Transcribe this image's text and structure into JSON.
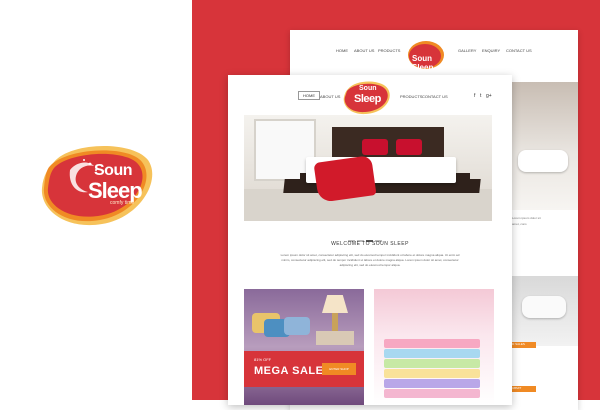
{
  "brand": {
    "name_line1": "Soun",
    "name_line2": "Sleep",
    "tagline": "comfy time",
    "color_primary": "#d7343a",
    "color_accent": "#f08a24",
    "color_highlight": "#f6c25a"
  },
  "back_window": {
    "nav": [
      "HOME",
      "ABOUT US",
      "PRODUCTS",
      "GALLERY",
      "ENQUIRY",
      "CONTACT US"
    ],
    "logo_text": "Soun Sleep",
    "side_text_1": "Lorem ipsum dolor sit",
    "side_text_2": "amet, cons",
    "side_label_1": "S",
    "side_label_2": "LAB",
    "side_orange_1": "ND SALES",
    "side_orange_2": "SUBMIT"
  },
  "front_window": {
    "nav": {
      "home": "HOME",
      "about": "ABOUT US",
      "products": "PRODUCTS",
      "contact": "CONTACT US"
    },
    "social": [
      "f",
      "t",
      "g+"
    ],
    "logo_line1": "Soun",
    "logo_line2": "Sleep",
    "welcome_title": "WELCOME TO SOUN SLEEP",
    "welcome_text": "Lorem ipsum dolor sit amet, consectetur adipiscing elit, sed do eiusmod tempor incididunt ut labore et dolore magna aliqua. Ut enim ad minim, consectetur adipiscing elit, sed do tempor incididunt ut labore et dolore magna aliqua. Lorem ipsum dolor sit amet, consectetur adipiscing elit, sed do eiusmod tempor aliqua.",
    "slider": {
      "total": 4,
      "active": 2
    },
    "promo": {
      "discount": "81% OFF",
      "headline": "MEGA SALE",
      "button": "ENTER SHOP"
    }
  }
}
